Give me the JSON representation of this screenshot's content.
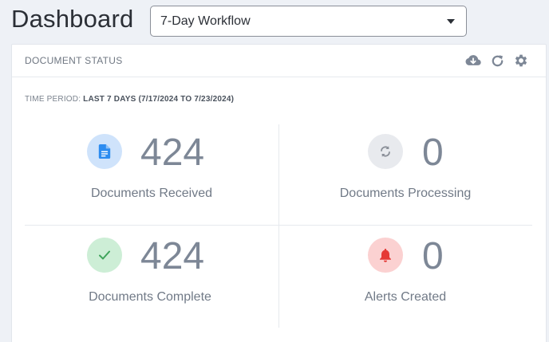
{
  "page": {
    "title": "Dashboard"
  },
  "workflow_select": {
    "value": "7-Day Workflow"
  },
  "card": {
    "title": "DOCUMENT STATUS",
    "tools": [
      "cloud-download-icon",
      "refresh-icon",
      "gear-icon"
    ],
    "period_label": "TIME PERIOD:",
    "period_value": "LAST 7 DAYS (7/17/2024 TO 7/23/2024)"
  },
  "stats": [
    {
      "value": "424",
      "label": "Documents Received",
      "icon": "document-icon",
      "color": "#2d8cf0",
      "bg": "#cfe3fb"
    },
    {
      "value": "0",
      "label": "Documents Processing",
      "icon": "sync-icon",
      "color": "#8a8f98",
      "bg": "#e8eaee"
    },
    {
      "value": "424",
      "label": "Documents Complete",
      "icon": "check-icon",
      "color": "#3fa45b",
      "bg": "#cdeed6"
    },
    {
      "value": "0",
      "label": "Alerts Created",
      "icon": "bell-icon",
      "color": "#e53935",
      "bg": "#fbd1d1"
    }
  ]
}
